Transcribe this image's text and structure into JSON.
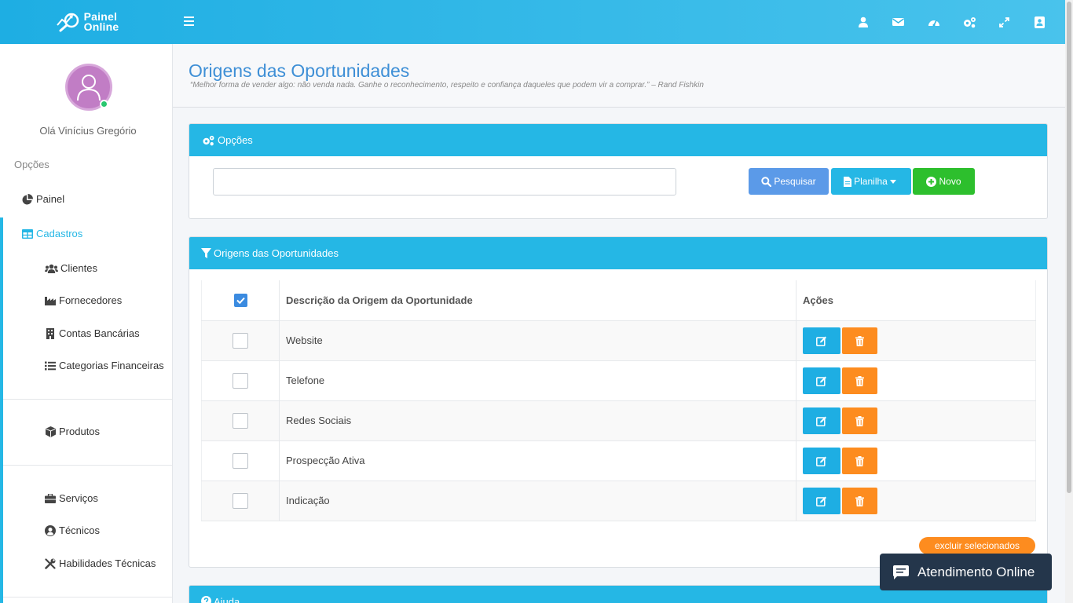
{
  "brand": {
    "line1": "Painel",
    "line2": "Online"
  },
  "topbar": {
    "menu_icon": "hamburger-icon",
    "icons": [
      "user-icon",
      "envelope-icon",
      "dashboard-icon",
      "cogs-icon",
      "expand-icon",
      "address-book-icon"
    ]
  },
  "sidebar": {
    "greeting": "Olá Vinícius Gregório",
    "section_label": "Opções",
    "painel": "Painel",
    "cadastros": "Cadastros",
    "items": {
      "clientes": "Clientes",
      "fornecedores": "Fornecedores",
      "contas": "Contas Bancárias",
      "categorias": "Categorias Financeiras",
      "produtos": "Produtos",
      "servicos": "Serviços",
      "tecnicos": "Técnicos",
      "habilidades": "Habilidades Técnicas"
    }
  },
  "page": {
    "title": "Origens das Oportunidades",
    "quote": "“Melhor forma de vender algo: não venda nada. Ganhe o reconhecimento, respeito e confiança daqueles que podem vir a comprar.” – Rand Fishkin"
  },
  "options_card": {
    "title": "Opções",
    "search_value": "",
    "search_label": "Pesquisar",
    "sheet_label": "Planilha",
    "new_label": "Novo"
  },
  "table_card": {
    "title": "Origens das Oportunidades",
    "columns": {
      "description": "Descrição da Origem da Oportunidade",
      "actions": "Ações"
    },
    "rows": [
      "Website",
      "Telefone",
      "Redes Sociais",
      "Prospecção Ativa",
      "Indicação"
    ],
    "delete_selected": "excluir selecionados"
  },
  "help_card": {
    "title": "Ajuda"
  },
  "chat": {
    "label": "Atendimento Online"
  },
  "colors": {
    "primary": "#25b7e5",
    "search_button": "#5b9ae8",
    "new_button": "#2dbf2d",
    "delete": "#fd8c1f",
    "title": "#3e8fd6",
    "chat_bg": "#24364b"
  }
}
